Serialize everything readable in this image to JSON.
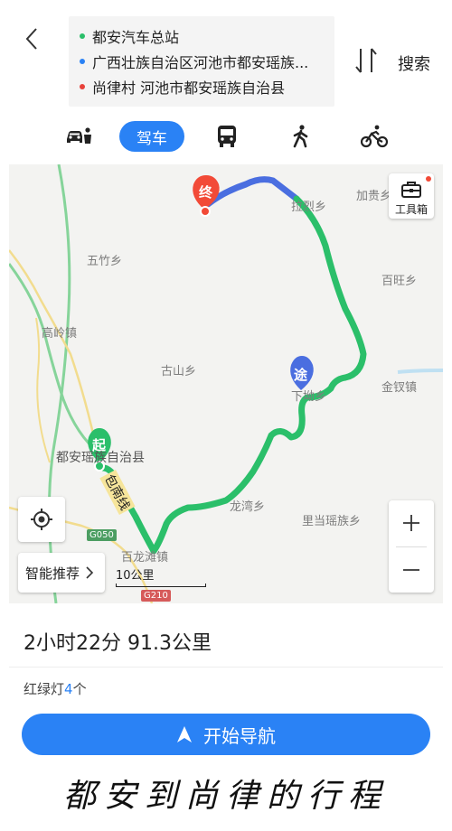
{
  "header": {
    "stops": [
      {
        "label": "都安汽车总站",
        "color": "#2bbf6a"
      },
      {
        "label": "广西壮族自治区河池市都安瑶族...",
        "color": "#2a82f5"
      },
      {
        "label": "尚律村 河池市都安瑶族自治县",
        "color": "#e8413a"
      }
    ],
    "search_label": "搜索"
  },
  "tabs": {
    "drive_label": "驾车",
    "icons": [
      "taxi-icon",
      "bus-icon",
      "walk-icon",
      "bike-icon"
    ]
  },
  "map": {
    "toolbox_label": "工具箱",
    "smart_label": "智能推荐",
    "scale_label": "10公里",
    "marker_start": "起",
    "marker_via": "途",
    "marker_end": "终",
    "road_name": "包南线",
    "road_g050": "G050",
    "road_g210": "G210",
    "places": {
      "jiagui": "加贵乡",
      "lalie": "拉烈乡",
      "wuzhu": "五竹乡",
      "baiwang": "百旺乡",
      "gaoling": "高岭镇",
      "gushan": "古山乡",
      "jinchai": "金钗镇",
      "xiuxue": "下坳乡",
      "duan": "都安瑶族自治县",
      "longwan": "龙湾乡",
      "lidang": "里当瑶族乡",
      "bailongtan": "百龙滩镇"
    },
    "colors": {
      "route_green": "#2bbf6a",
      "route_blue": "#4a6ee0",
      "badge_red": "#f24a37"
    }
  },
  "summary": {
    "time_distance": "2小时22分   91.3公里",
    "lights_prefix": "红绿灯",
    "lights_count": "4",
    "lights_suffix": "个"
  },
  "nav": {
    "start_label": "开始导航"
  },
  "caption": "都安到尚律的行程"
}
